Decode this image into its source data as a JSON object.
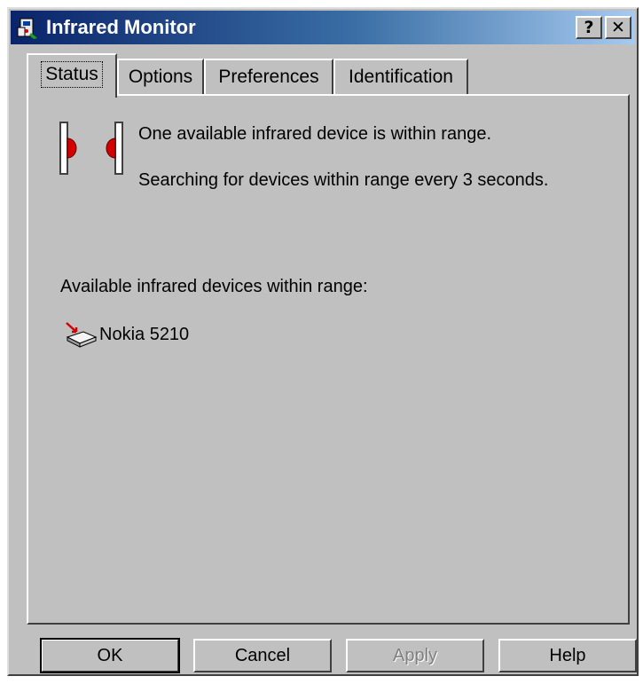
{
  "window": {
    "title": "Infrared Monitor",
    "help_button": "?",
    "close_button": "✕",
    "icon": "infrared-monitor-icon"
  },
  "tabs": [
    {
      "label": "Status",
      "active": true
    },
    {
      "label": "Options",
      "active": false
    },
    {
      "label": "Preferences",
      "active": false
    },
    {
      "label": "Identification",
      "active": false
    }
  ],
  "status": {
    "icon": "infrared-range-icon",
    "line1": "One available infrared device is within range.",
    "line2": "Searching for devices within range every 3 seconds."
  },
  "devices": {
    "label": "Available infrared devices within range:",
    "items": [
      {
        "name": "Nokia 5210",
        "icon": "infrared-device-icon"
      }
    ]
  },
  "buttons": {
    "ok": "OK",
    "cancel": "Cancel",
    "apply": "Apply",
    "help": "Help"
  },
  "colors": {
    "title_start": "#0a246a",
    "title_end": "#a6caf0",
    "face": "#c0c0c0",
    "ir_red": "#d40000"
  }
}
